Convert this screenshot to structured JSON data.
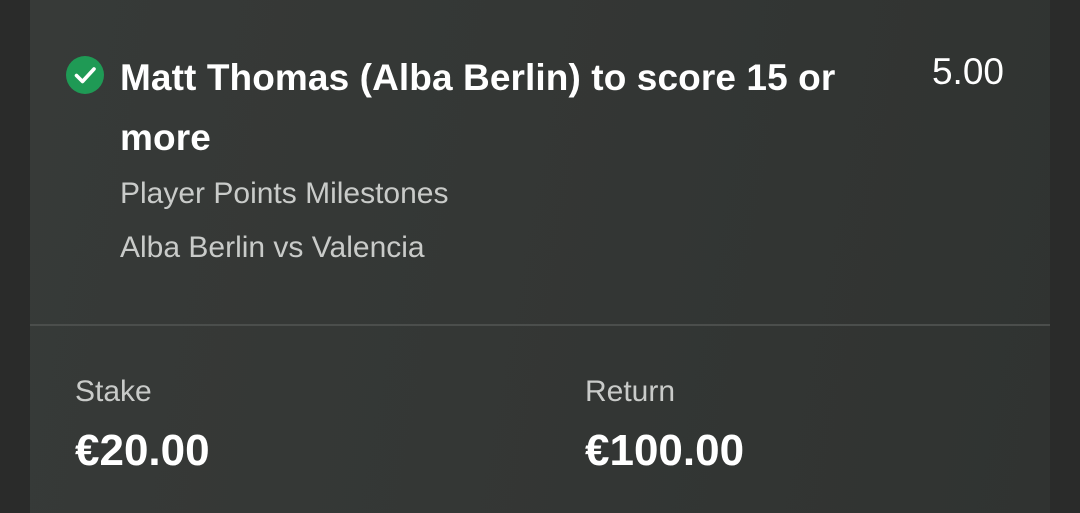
{
  "bet": {
    "status_icon": "check-circle-icon",
    "status_color": "#1f9a55",
    "selection": "Matt Thomas (Alba Berlin) to score 15 or more",
    "odds": "5.00",
    "market": "Player Points Milestones",
    "event": "Alba Berlin vs Valencia"
  },
  "summary": {
    "stake_label": "Stake",
    "stake_value": "€20.00",
    "return_label": "Return",
    "return_value": "€100.00"
  }
}
